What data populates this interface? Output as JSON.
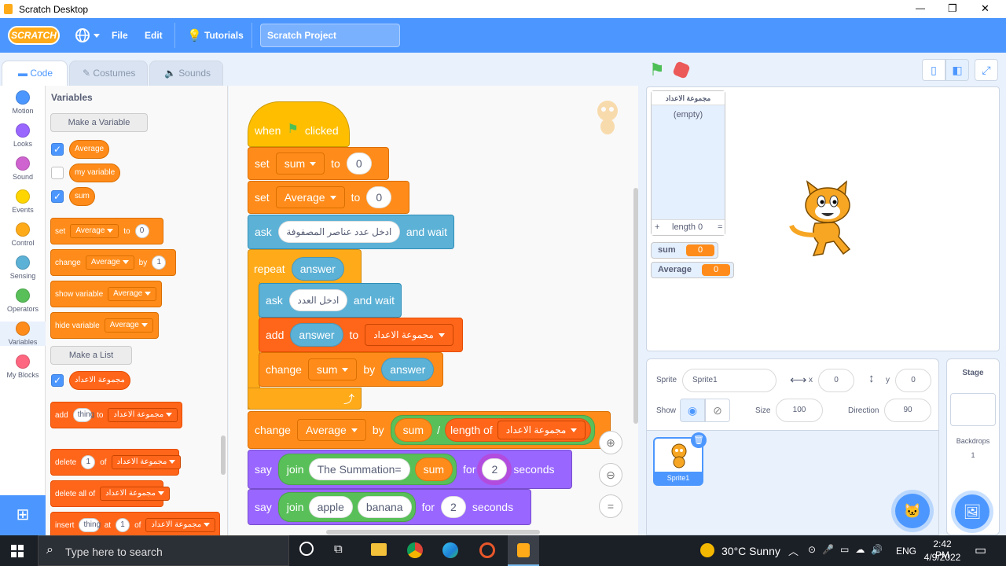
{
  "window": {
    "title": "Scratch Desktop",
    "min": "—",
    "max": "❐",
    "close": "✕"
  },
  "menubar": {
    "logo": "SCRATCH",
    "file": "File",
    "edit": "Edit",
    "tutorials": "Tutorials",
    "project_title": "Scratch Project"
  },
  "tabs": {
    "code": "Code",
    "costumes": "Costumes",
    "sounds": "Sounds"
  },
  "categories": [
    {
      "label": "Motion",
      "color": "#4c97ff"
    },
    {
      "label": "Looks",
      "color": "#9966ff"
    },
    {
      "label": "Sound",
      "color": "#cf63cf"
    },
    {
      "label": "Events",
      "color": "#ffd500"
    },
    {
      "label": "Control",
      "color": "#ffab19"
    },
    {
      "label": "Sensing",
      "color": "#5cb1d6"
    },
    {
      "label": "Operators",
      "color": "#59c059"
    },
    {
      "label": "Variables",
      "color": "#ff8c1a"
    },
    {
      "label": "My Blocks",
      "color": "#ff6680"
    }
  ],
  "palette": {
    "heading": "Variables",
    "make_variable": "Make a Variable",
    "variables": [
      "Average",
      "my variable",
      "sum"
    ],
    "set": {
      "verb": "set",
      "var": "Average",
      "to": "to",
      "val": "0"
    },
    "change": {
      "verb": "change",
      "var": "Average",
      "by": "by",
      "val": "1"
    },
    "show": {
      "verb": "show variable",
      "var": "Average"
    },
    "hide": {
      "verb": "hide variable",
      "var": "Average"
    },
    "make_list": "Make a List",
    "list_name": "مجموعة الاعداد",
    "add": {
      "verb": "add",
      "item": "thing",
      "to": "to"
    },
    "delete": {
      "verb": "delete",
      "num": "1",
      "of": "of"
    },
    "delete_all": {
      "verb": "delete all of"
    },
    "insert": {
      "verb": "insert",
      "item": "thing",
      "at": "at",
      "num": "1",
      "of": "of"
    }
  },
  "script": {
    "when": "when",
    "clicked": "clicked",
    "set1": {
      "verb": "set",
      "var": "sum",
      "to": "to",
      "val": "0"
    },
    "set2": {
      "verb": "set",
      "var": "Average",
      "to": "to",
      "val": "0"
    },
    "ask1": {
      "verb": "ask",
      "q": "ادخل عدد عناصر المصفوفة",
      "wait": "and wait"
    },
    "repeat": {
      "verb": "repeat",
      "arg": "answer"
    },
    "ask2": {
      "verb": "ask",
      "q": "ادخل العدد",
      "wait": "and wait"
    },
    "add": {
      "verb": "add",
      "item": "answer",
      "to": "to",
      "list": "مجموعة الاعداد"
    },
    "change1": {
      "verb": "change",
      "var": "sum",
      "by": "by",
      "val": "answer"
    },
    "change2": {
      "verb": "change",
      "var": "Average",
      "by": "by",
      "a": "sum",
      "op": "/",
      "length": "length of",
      "list": "مجموعة الاعداد"
    },
    "say1": {
      "verb": "say",
      "join": "join",
      "a": "The Summation=",
      "b": "sum",
      "for": "for",
      "n": "2",
      "sec": "seconds"
    },
    "say2": {
      "verb": "say",
      "join": "join",
      "a": "apple",
      "b": "banana",
      "for": "for",
      "n": "2",
      "sec": "seconds"
    }
  },
  "stage": {
    "list_title": "مجموعة الاعداد",
    "list_empty": "(empty)",
    "list_plus": "+",
    "list_length": "length 0",
    "list_eq": "=",
    "monitors": [
      {
        "name": "sum",
        "value": "0"
      },
      {
        "name": "Average",
        "value": "0"
      }
    ]
  },
  "sprite": {
    "sprite_label": "Sprite",
    "name": "Sprite1",
    "x_label": "x",
    "x": "0",
    "y_label": "y",
    "y": "0",
    "show_label": "Show",
    "size_label": "Size",
    "size": "100",
    "direction_label": "Direction",
    "direction": "90",
    "thumb_name": "Sprite1"
  },
  "stage_pane": {
    "title": "Stage",
    "backdrops": "Backdrops",
    "count": "1"
  },
  "taskbar": {
    "search": "Type here to search",
    "weather": "30°C  Sunny",
    "lang": "ENG",
    "time": "2:42 PM",
    "date": "4/9/2022"
  }
}
